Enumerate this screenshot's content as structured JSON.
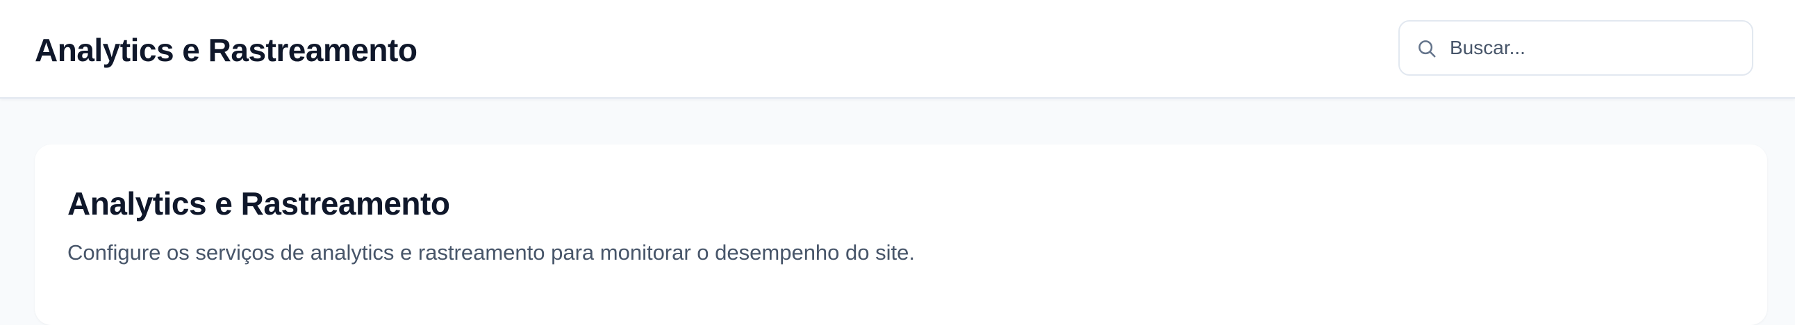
{
  "header": {
    "title": "Analytics e Rastreamento"
  },
  "search": {
    "placeholder": "Buscar...",
    "value": "",
    "icon": "search-icon"
  },
  "card": {
    "title": "Analytics e Rastreamento",
    "description": "Configure os serviços de analytics e rastreamento para monitorar o desempenho do site."
  },
  "colors": {
    "page_background": "#f8fafc",
    "surface": "#ffffff",
    "heading": "#0f172a",
    "muted_text": "#475569",
    "border": "#e2e8f0"
  }
}
